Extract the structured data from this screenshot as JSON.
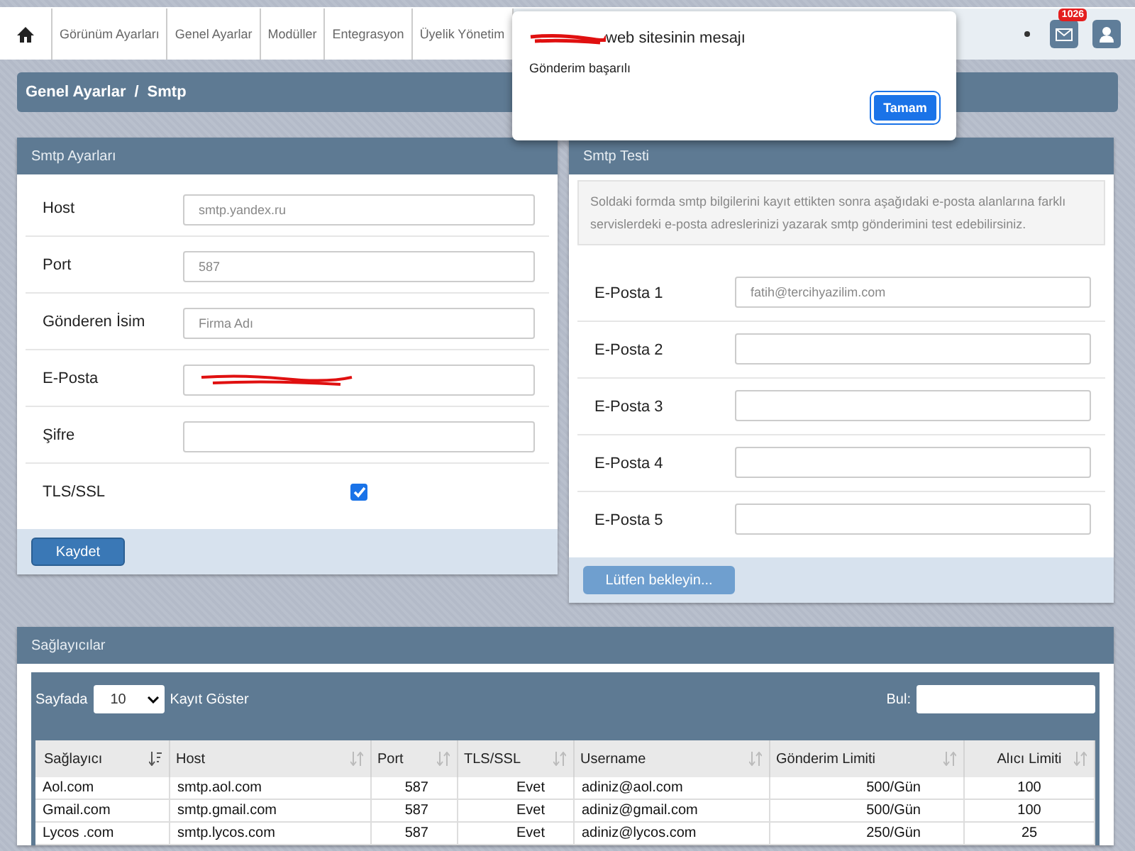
{
  "nav": {
    "items": [
      {
        "label": "Görünüm Ayarları"
      },
      {
        "label": "Genel Ayarlar"
      },
      {
        "label": "Modüller"
      },
      {
        "label": "Entegrasyon"
      },
      {
        "label": "Üyelik Yönetim"
      }
    ],
    "mail_badge": "1026"
  },
  "breadcrumb": [
    "Genel Ayarlar",
    "/",
    "Smtp"
  ],
  "smtp_settings": {
    "title": "Smtp Ayarları",
    "fields": [
      {
        "kind": "text",
        "label": "Host",
        "value": "smtp.yandex.ru"
      },
      {
        "kind": "text",
        "label": "Port",
        "value": "587"
      },
      {
        "kind": "text",
        "label": "Gönderen İsim",
        "value": "Firma Adı"
      },
      {
        "kind": "redacted",
        "label": "E-Posta"
      },
      {
        "kind": "text",
        "label": "Şifre"
      },
      {
        "kind": "checkbox",
        "label": "TLS/SSL",
        "checked": true
      }
    ],
    "button": "Kaydet"
  },
  "smtp_test": {
    "title": "Smtp Testi",
    "info": "Soldaki formda smtp bilgilerini kayıt ettikten sonra aşağıdaki e-posta alanlarına farklı servislerdeki e-posta adreslerinizi yazarak smtp gönderimini test edebilirsiniz.",
    "fields": [
      {
        "label": "E-Posta 1",
        "value": "fatih@tercihyazilim.com"
      },
      {
        "label": "E-Posta 2"
      },
      {
        "label": "E-Posta 3"
      },
      {
        "label": "E-Posta 4"
      },
      {
        "label": "E-Posta 5"
      }
    ],
    "button": {
      "label": "Lütfen bekleyin...",
      "disabled": true
    }
  },
  "providers": {
    "title": "Sağlayıcılar",
    "page_size_label": "Sayfada",
    "page_size": "10",
    "page_size_suffix": "Kayıt Göster",
    "search_label": "Bul:",
    "columns": [
      {
        "label": "Sağlayıcı",
        "sorted": true
      },
      {
        "label": "Host",
        "sorted": false
      },
      {
        "label": "Port",
        "sorted": false
      },
      {
        "label": "TLS/SSL",
        "sorted": false
      },
      {
        "label": "Username",
        "sorted": false
      },
      {
        "label": "Gönderim Limiti",
        "sorted": false
      },
      {
        "label": "Alıcı Limiti",
        "sorted": false
      }
    ],
    "rows": [
      [
        "Aol.com",
        "smtp.aol.com",
        "587",
        "Evet",
        "adiniz@aol.com",
        "500/Gün",
        "100"
      ],
      [
        "Gmail.com",
        "smtp.gmail.com",
        "587",
        "Evet",
        "adiniz@gmail.com",
        "500/Gün",
        "100"
      ],
      [
        "Lycos .com",
        "smtp.lycos.com",
        "587",
        "Evet",
        "adiniz@lycos.com",
        "250/Gün",
        "25"
      ]
    ]
  },
  "alert": {
    "title": "web sitesinin mesajı",
    "message": "Gönderim başarılı",
    "button": "Tamam"
  }
}
